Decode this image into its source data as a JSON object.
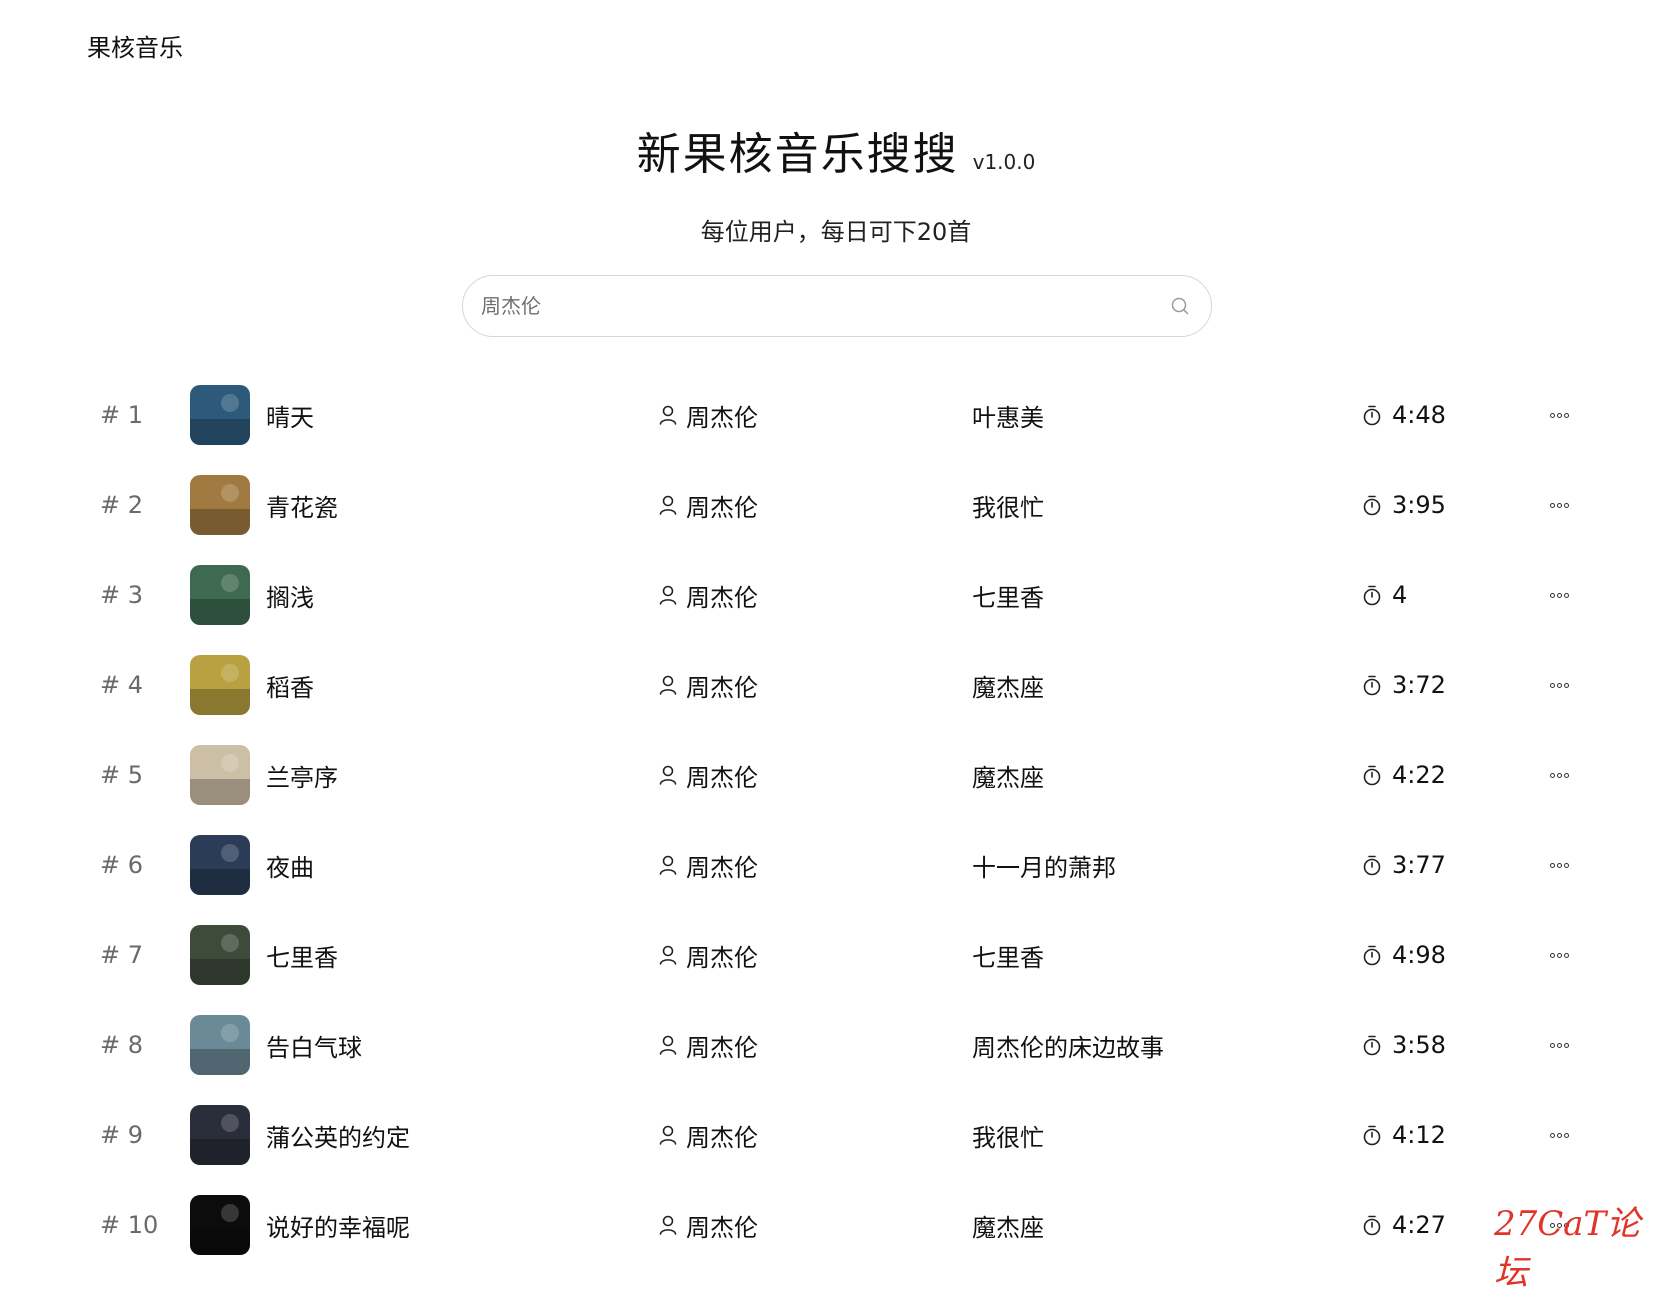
{
  "brand": "果核音乐",
  "hero": {
    "title": "新果核音乐搜搜",
    "version": "v1.0.0",
    "subtitle": "每位用户，每日可下20首"
  },
  "search": {
    "placeholder": "周杰伦",
    "icon": "search-icon"
  },
  "songs": [
    {
      "rank": "# 1",
      "title": "晴天",
      "artist": "周杰伦",
      "album": "叶惠美",
      "duration": "4:48",
      "cover_color": "#2d5a7a"
    },
    {
      "rank": "# 2",
      "title": "青花瓷",
      "artist": "周杰伦",
      "album": "我很忙",
      "duration": "3:95",
      "cover_color": "#a07a40"
    },
    {
      "rank": "# 3",
      "title": "搁浅",
      "artist": "周杰伦",
      "album": "七里香",
      "duration": "4",
      "cover_color": "#3f6a52"
    },
    {
      "rank": "# 4",
      "title": "稻香",
      "artist": "周杰伦",
      "album": "魔杰座",
      "duration": "3:72",
      "cover_color": "#b9a040"
    },
    {
      "rank": "# 5",
      "title": "兰亭序",
      "artist": "周杰伦",
      "album": "魔杰座",
      "duration": "4:22",
      "cover_color": "#cdbfa6"
    },
    {
      "rank": "# 6",
      "title": "夜曲",
      "artist": "周杰伦",
      "album": "十一月的萧邦",
      "duration": "3:77",
      "cover_color": "#2a3c57"
    },
    {
      "rank": "# 7",
      "title": "七里香",
      "artist": "周杰伦",
      "album": "七里香",
      "duration": "4:98",
      "cover_color": "#3e4a3a"
    },
    {
      "rank": "# 8",
      "title": "告白气球",
      "artist": "周杰伦",
      "album": "周杰伦的床边故事",
      "duration": "3:58",
      "cover_color": "#6b8a97"
    },
    {
      "rank": "# 9",
      "title": "蒲公英的约定",
      "artist": "周杰伦",
      "album": "我很忙",
      "duration": "4:12",
      "cover_color": "#2a2e3a"
    },
    {
      "rank": "# 10",
      "title": "说好的幸福呢",
      "artist": "周杰伦",
      "album": "魔杰座",
      "duration": "4:27",
      "cover_color": "#0c0c0c"
    }
  ],
  "watermark": "27CaT论坛"
}
